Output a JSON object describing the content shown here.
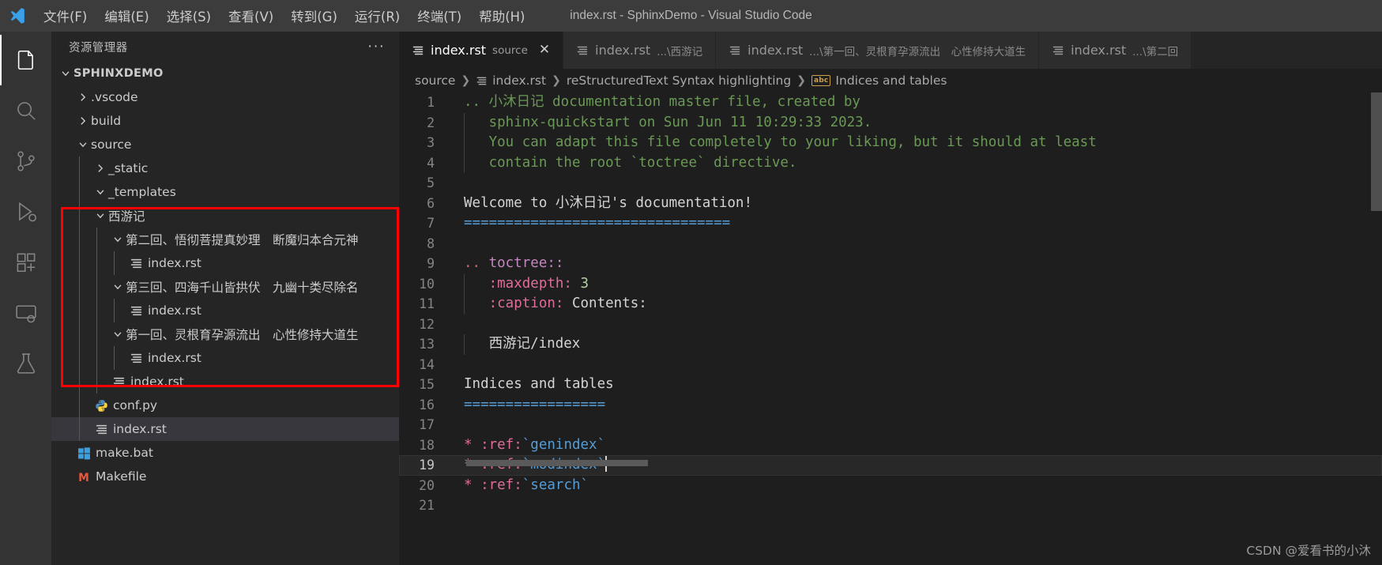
{
  "titlebar": {
    "logo_icon": "vscode-logo-icon",
    "title": "index.rst - SphinxDemo - Visual Studio Code",
    "menus": [
      {
        "label": "文件(F)"
      },
      {
        "label": "编辑(E)"
      },
      {
        "label": "选择(S)"
      },
      {
        "label": "查看(V)"
      },
      {
        "label": "转到(G)"
      },
      {
        "label": "运行(R)"
      },
      {
        "label": "终端(T)"
      },
      {
        "label": "帮助(H)"
      }
    ]
  },
  "activitybar": {
    "items": [
      {
        "icon": "explorer-files-icon",
        "name": "explorer",
        "active": true
      },
      {
        "icon": "search-icon",
        "name": "search",
        "active": false
      },
      {
        "icon": "source-control-icon",
        "name": "source-control",
        "active": false
      },
      {
        "icon": "run-debug-icon",
        "name": "run-and-debug",
        "active": false
      },
      {
        "icon": "extensions-icon",
        "name": "extensions",
        "active": false
      },
      {
        "icon": "remote-explorer-icon",
        "name": "remote-explorer",
        "active": false
      },
      {
        "icon": "testing-beaker-icon",
        "name": "testing",
        "active": false
      }
    ]
  },
  "sidebar": {
    "title": "资源管理器",
    "more_actions": "···",
    "tree": [
      {
        "label": "SPHINXDEMO",
        "kind": "root",
        "depth": 0,
        "expanded": true,
        "icon": null,
        "selected": false
      },
      {
        "label": ".vscode",
        "kind": "folder",
        "depth": 1,
        "expanded": false,
        "icon": null,
        "selected": false
      },
      {
        "label": "build",
        "kind": "folder",
        "depth": 1,
        "expanded": false,
        "icon": null,
        "selected": false
      },
      {
        "label": "source",
        "kind": "folder",
        "depth": 1,
        "expanded": true,
        "icon": null,
        "selected": false
      },
      {
        "label": "_static",
        "kind": "folder",
        "depth": 2,
        "expanded": false,
        "icon": null,
        "selected": false
      },
      {
        "label": "_templates",
        "kind": "folder",
        "depth": 2,
        "expanded": true,
        "icon": null,
        "selected": false
      },
      {
        "label": "西游记",
        "kind": "folder",
        "depth": 2,
        "expanded": true,
        "icon": null,
        "selected": false
      },
      {
        "label": "第二回、悟彻菩提真妙理　断魔归本合元神",
        "kind": "folder",
        "depth": 3,
        "expanded": true,
        "icon": null,
        "selected": false
      },
      {
        "label": "index.rst",
        "kind": "file",
        "depth": 4,
        "expanded": null,
        "icon": "rst-file-icon",
        "selected": false
      },
      {
        "label": "第三回、四海千山皆拱伏　九幽十类尽除名",
        "kind": "folder",
        "depth": 3,
        "expanded": true,
        "icon": null,
        "selected": false
      },
      {
        "label": "index.rst",
        "kind": "file",
        "depth": 4,
        "expanded": null,
        "icon": "rst-file-icon",
        "selected": false
      },
      {
        "label": "第一回、灵根育孕源流出　心性修持大道生",
        "kind": "folder",
        "depth": 3,
        "expanded": true,
        "icon": null,
        "selected": false
      },
      {
        "label": "index.rst",
        "kind": "file",
        "depth": 4,
        "expanded": null,
        "icon": "rst-file-icon",
        "selected": false
      },
      {
        "label": "index.rst",
        "kind": "file",
        "depth": 3,
        "expanded": null,
        "icon": "rst-file-icon",
        "selected": false
      },
      {
        "label": "conf.py",
        "kind": "file",
        "depth": 2,
        "expanded": null,
        "icon": "python-file-icon",
        "selected": false
      },
      {
        "label": "index.rst",
        "kind": "file",
        "depth": 2,
        "expanded": null,
        "icon": "rst-file-icon",
        "selected": true
      },
      {
        "label": "make.bat",
        "kind": "file",
        "depth": 1,
        "expanded": null,
        "icon": "windows-bat-icon",
        "selected": false
      },
      {
        "label": "Makefile",
        "kind": "file",
        "depth": 1,
        "expanded": null,
        "icon": "makefile-icon",
        "selected": false
      }
    ]
  },
  "editor": {
    "tabs": [
      {
        "name": "index.rst",
        "description": "source",
        "active": true,
        "closable": true,
        "icon": "rst-file-icon"
      },
      {
        "name": "index.rst",
        "description": "...\\西游记",
        "active": false,
        "closable": false,
        "icon": "rst-file-icon"
      },
      {
        "name": "index.rst",
        "description": "...\\第一回、灵根育孕源流出　心性修持大道生",
        "active": false,
        "closable": false,
        "icon": "rst-file-icon"
      },
      {
        "name": "index.rst",
        "description": "...\\第二回",
        "active": false,
        "closable": false,
        "icon": "rst-file-icon"
      }
    ],
    "close_glyph": "✕",
    "breadcrumbs": [
      {
        "label": "source",
        "icon": null
      },
      {
        "label": "index.rst",
        "icon": "rst-file-icon"
      },
      {
        "label": "reStructuredText Syntax highlighting",
        "icon": null
      },
      {
        "label": "Indices and tables",
        "icon": "abc-symbol-icon"
      }
    ],
    "breadcrumb_separator": "❯",
    "current_line": 19,
    "lines": [
      {
        "n": 1,
        "indent_guide": false,
        "tokens": [
          {
            "t": ".. ",
            "c": "c-comment"
          },
          {
            "t": "小沐日记 documentation master file, created by",
            "c": "c-comment"
          }
        ]
      },
      {
        "n": 2,
        "indent_guide": true,
        "tokens": [
          {
            "t": "   sphinx-quickstart on Sun Jun 11 10:29:33 2023.",
            "c": "c-comment"
          }
        ]
      },
      {
        "n": 3,
        "indent_guide": true,
        "tokens": [
          {
            "t": "   You can adapt this file completely to your liking, but it should at least",
            "c": "c-comment"
          }
        ]
      },
      {
        "n": 4,
        "indent_guide": true,
        "tokens": [
          {
            "t": "   contain the root `toctree` directive.",
            "c": "c-comment"
          }
        ]
      },
      {
        "n": 5,
        "indent_guide": true,
        "tokens": []
      },
      {
        "n": 6,
        "indent_guide": false,
        "tokens": [
          {
            "t": "Welcome to 小沐日记's documentation!",
            "c": "c-white"
          }
        ]
      },
      {
        "n": 7,
        "indent_guide": false,
        "tokens": [
          {
            "t": "================================",
            "c": "c-blue"
          }
        ]
      },
      {
        "n": 8,
        "indent_guide": false,
        "tokens": []
      },
      {
        "n": 9,
        "indent_guide": false,
        "tokens": [
          {
            "t": ".. ",
            "c": "c-rose"
          },
          {
            "t": "toctree::",
            "c": "c-pink"
          }
        ]
      },
      {
        "n": 10,
        "indent_guide": true,
        "tokens": [
          {
            "t": "   :maxdepth:",
            "c": "c-magenta"
          },
          {
            "t": " ",
            "c": "c-white"
          },
          {
            "t": "3",
            "c": "c-green"
          }
        ]
      },
      {
        "n": 11,
        "indent_guide": true,
        "tokens": [
          {
            "t": "   :caption:",
            "c": "c-magenta"
          },
          {
            "t": " Contents:",
            "c": "c-white"
          }
        ]
      },
      {
        "n": 12,
        "indent_guide": true,
        "tokens": []
      },
      {
        "n": 13,
        "indent_guide": true,
        "tokens": [
          {
            "t": "   西游记/index",
            "c": "c-white"
          }
        ]
      },
      {
        "n": 14,
        "indent_guide": true,
        "tokens": []
      },
      {
        "n": 15,
        "indent_guide": false,
        "tokens": [
          {
            "t": "Indices and tables",
            "c": "c-white"
          }
        ]
      },
      {
        "n": 16,
        "indent_guide": false,
        "tokens": [
          {
            "t": "=================",
            "c": "c-blue"
          }
        ]
      },
      {
        "n": 17,
        "indent_guide": false,
        "tokens": []
      },
      {
        "n": 18,
        "indent_guide": false,
        "tokens": [
          {
            "t": "* ",
            "c": "c-magenta"
          },
          {
            "t": ":ref:",
            "c": "c-magenta"
          },
          {
            "t": "`genindex`",
            "c": "c-linkblue"
          }
        ]
      },
      {
        "n": 19,
        "indent_guide": false,
        "tokens": [
          {
            "t": "* ",
            "c": "c-magenta"
          },
          {
            "t": ":ref:",
            "c": "c-magenta"
          },
          {
            "t": "`modindex`",
            "c": "c-linkblue"
          }
        ],
        "caret": true
      },
      {
        "n": 20,
        "indent_guide": false,
        "tokens": [
          {
            "t": "* ",
            "c": "c-magenta"
          },
          {
            "t": ":ref:",
            "c": "c-magenta"
          },
          {
            "t": "`search`",
            "c": "c-linkblue"
          }
        ]
      },
      {
        "n": 21,
        "indent_guide": false,
        "tokens": []
      }
    ]
  },
  "watermark": "CSDN @爱看书的小沐",
  "colors": {
    "accent_red_annotation": "#ff0000",
    "editor_background": "#1e1e1e",
    "sidebar_background": "#252526",
    "titlebar_background": "#3c3c3c",
    "activitybar_background": "#333333",
    "selection_background": "#37373d"
  }
}
